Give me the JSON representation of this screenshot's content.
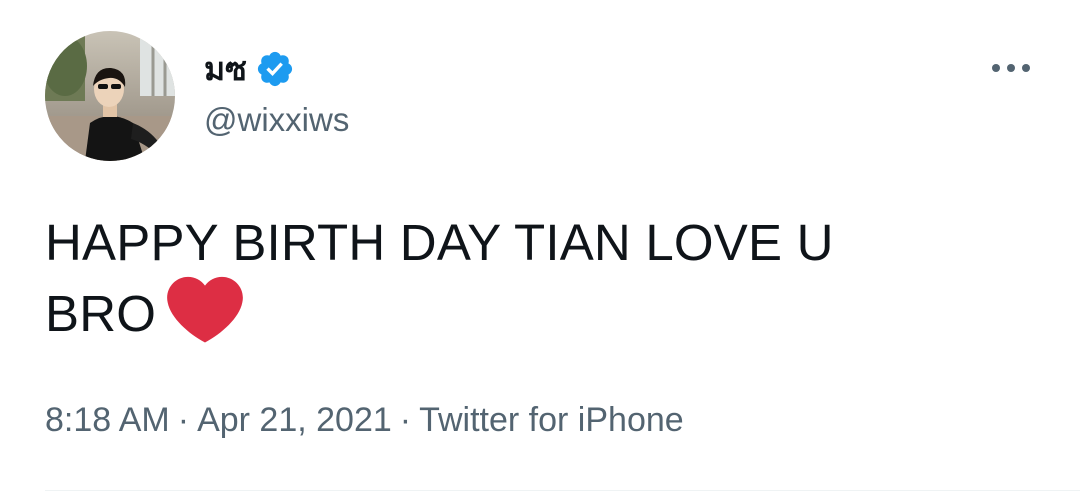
{
  "author": {
    "display_name": "มซ",
    "handle": "@wixxiws",
    "verified": true,
    "avatar_icon": "profile-photo"
  },
  "tweet": {
    "text_line_1": "HAPPY BIRTH DAY TIAN LOVE U",
    "text_line_2": "BRO",
    "emoji": "red-heart",
    "time": "8:18 AM",
    "date": "Apr 21, 2021",
    "source": "Twitter for iPhone",
    "separator": "·"
  },
  "actions": {
    "more_icon": "more-horizontal-icon"
  },
  "colors": {
    "verified_blue": "#1d9bf0",
    "heart_red": "#dd2e44",
    "secondary_text": "#536471",
    "primary_text": "#0f1419"
  }
}
